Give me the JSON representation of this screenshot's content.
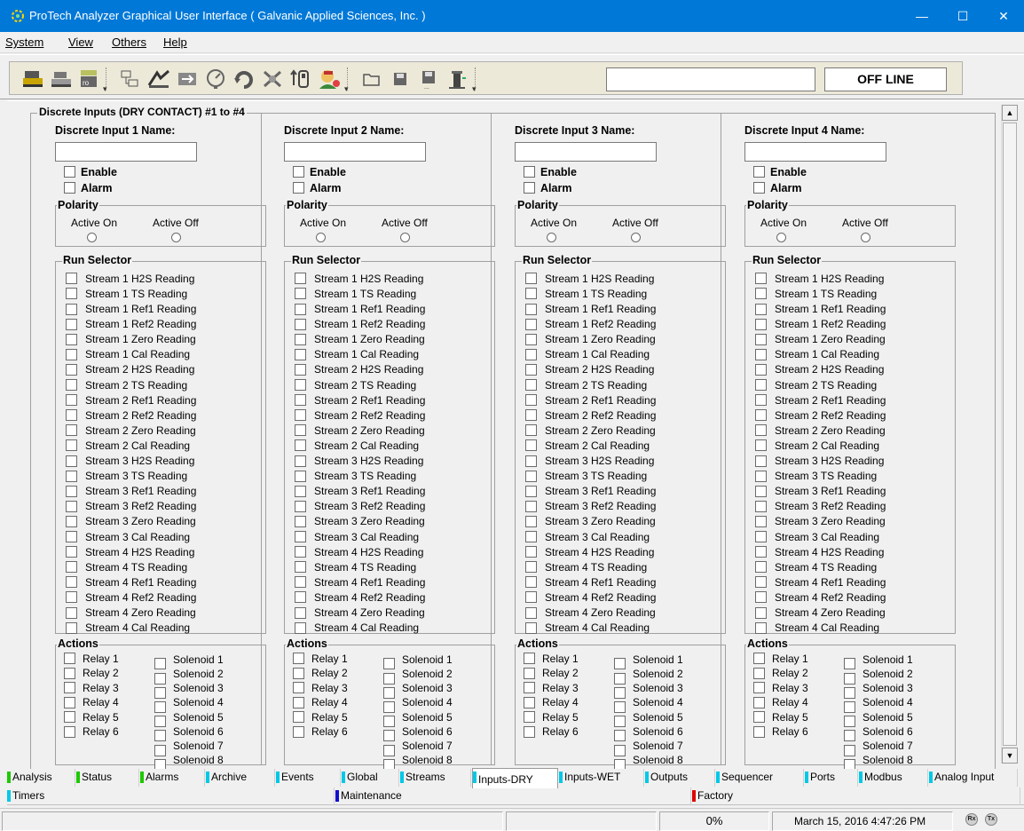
{
  "window": {
    "title": "ProTech Analyzer Graphical User Interface  ( Galvanic Applied Sciences, Inc. )",
    "minimize": "—",
    "maximize": "☐",
    "close": "✕"
  },
  "menu": [
    "System",
    "View",
    "Others",
    "Help"
  ],
  "toolbar": {
    "status": "OFF LINE",
    "field_value": "",
    "icons": [
      "connect-icon",
      "disconnect-icon",
      "device-icon",
      "network-icon",
      "chart-icon",
      "transfer-icon",
      "gauge-icon",
      "refresh-icon",
      "fault-icon",
      "io-icon",
      "user-icon",
      "open-folder-icon",
      "save-icon",
      "save-as-icon",
      "tower-icon"
    ]
  },
  "section_title": "Discrete Inputs (DRY CONTACT) #1 to #4",
  "columns": [
    {
      "name_label": "Discrete Input 1 Name:",
      "name_value": ""
    },
    {
      "name_label": "Discrete Input 2 Name:",
      "name_value": ""
    },
    {
      "name_label": "Discrete Input 3 Name:",
      "name_value": ""
    },
    {
      "name_label": "Discrete Input 4 Name:",
      "name_value": ""
    }
  ],
  "labels": {
    "enable": "Enable",
    "alarm": "Alarm",
    "polarity": "Polarity",
    "active_on": "Active On",
    "active_off": "Active Off",
    "run_selector": "Run Selector",
    "actions": "Actions"
  },
  "run_items": [
    "Stream 1 H2S Reading",
    "Stream 1 TS Reading",
    "Stream 1 Ref1 Reading",
    "Stream 1 Ref2 Reading",
    "Stream 1 Zero Reading",
    "Stream 1 Cal Reading",
    "Stream 2 H2S Reading",
    "Stream 2 TS Reading",
    "Stream 2 Ref1 Reading",
    "Stream 2 Ref2 Reading",
    "Stream 2 Zero Reading",
    "Stream 2 Cal Reading",
    "Stream 3 H2S Reading",
    "Stream 3 TS Reading",
    "Stream 3 Ref1 Reading",
    "Stream 3 Ref2 Reading",
    "Stream 3 Zero Reading",
    "Stream 3 Cal Reading",
    "Stream 4 H2S Reading",
    "Stream 4 TS Reading",
    "Stream 4 Ref1 Reading",
    "Stream 4 Ref2 Reading",
    "Stream 4 Zero Reading",
    "Stream 4 Cal Reading"
  ],
  "relays": [
    "Relay 1",
    "Relay 2",
    "Relay 3",
    "Relay 4",
    "Relay 5",
    "Relay 6"
  ],
  "solenoids": [
    "Solenoid 1",
    "Solenoid 2",
    "Solenoid 3",
    "Solenoid 4",
    "Solenoid 5",
    "Solenoid 6",
    "Solenoid 7",
    "Solenoid 8"
  ],
  "tabs_row1": [
    {
      "label": "Analysis",
      "color": "#1ec800"
    },
    {
      "label": "Status",
      "color": "#1ec800"
    },
    {
      "label": "Alarms",
      "color": "#1ec800"
    },
    {
      "label": "Archive",
      "color": "#00c8e6"
    },
    {
      "label": "Events",
      "color": "#00c8e6"
    },
    {
      "label": "Global",
      "color": "#00c8e6"
    },
    {
      "label": "Streams",
      "color": "#00c8e6"
    },
    {
      "label": "Inputs-DRY",
      "color": "#00c8e6",
      "active": true
    },
    {
      "label": "Inputs-WET",
      "color": "#00c8e6"
    },
    {
      "label": "Outputs",
      "color": "#00c8e6"
    },
    {
      "label": "Sequencer",
      "color": "#00c8e6"
    },
    {
      "label": "Ports",
      "color": "#00c8e6"
    },
    {
      "label": "Modbus",
      "color": "#00c8e6"
    },
    {
      "label": "Analog Input",
      "color": "#00c8e6"
    }
  ],
  "tabs_row2": [
    {
      "label": "Timers",
      "color": "#00c8e6"
    },
    {
      "label": "Maintenance",
      "color": "#1010d0"
    },
    {
      "label": "Factory",
      "color": "#e00000"
    }
  ],
  "statusbar": {
    "progress": "0%",
    "datetime": "March 15, 2016 4:47:26 PM",
    "rx": "Rx",
    "tx": "Tx"
  }
}
